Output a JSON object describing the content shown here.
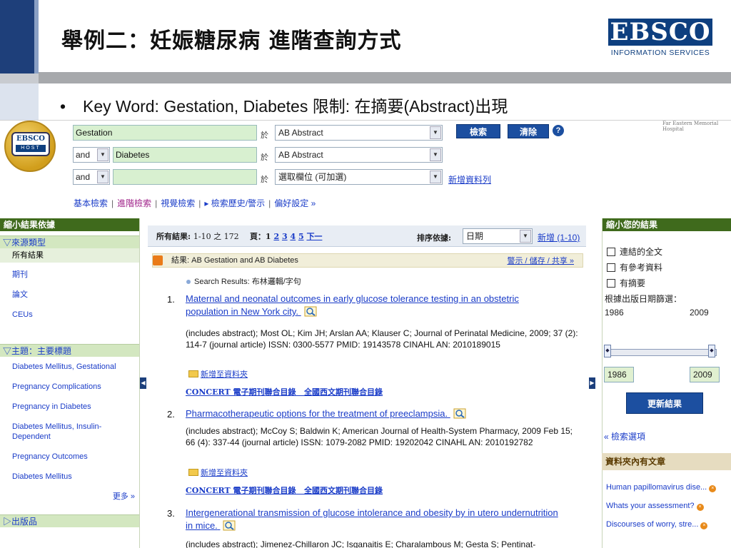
{
  "slide": {
    "title": "舉例二：妊娠糖尿病 進階查詢方式",
    "logo_name": "EBSCO",
    "logo_sub": "INFORMATION SERVICES",
    "bullet_text": "Key Word: Gestation, Diabetes  限制: 在摘要(Abstract)出現"
  },
  "search": {
    "host_logo_top": "EBSCO",
    "host_logo_bottom": "HOST",
    "row1_term": "Gestation",
    "row2_op": "and",
    "row2_term": "Diabetes",
    "row3_op": "and",
    "row3_term": "",
    "yu": "於",
    "row1_field": "AB Abstract",
    "row2_field": "AB Abstract",
    "row3_field": "選取欄位 (可加選)",
    "search_btn": "檢索",
    "clear_btn": "清除",
    "help": "?",
    "add_row": "新增資料列",
    "tabs": [
      "基本檢索",
      "進階檢索",
      "視覺檢索"
    ],
    "history": "▸ 檢索歷史/警示",
    "prefs": "偏好設定 »",
    "topright": "Far Eastern Memorial Hospital"
  },
  "left": {
    "title": "縮小結果依據",
    "source_types_header": "▽來源類型",
    "source_types": [
      "所有結果",
      "期刊",
      "論文",
      "CEUs"
    ],
    "subject_header": "▽主題：主要標題",
    "subjects": [
      "Diabetes Mellitus, Gestational",
      "Pregnancy Complications",
      "Pregnancy in Diabetes",
      "Diabetes Mellitus, Insulin-Dependent",
      "Pregnancy Outcomes",
      "Diabetes Mellitus"
    ],
    "more": "更多 »",
    "publication_header": "▷出版品"
  },
  "results": {
    "summary_label": "所有結果:",
    "summary_value": "1-10 之 172",
    "page_label": "頁：1",
    "pages": [
      "2",
      "3",
      "4",
      "5",
      "下一"
    ],
    "sort_label": "排序依據:",
    "sort_value": "日期",
    "newest": "新增 (1-10)",
    "feed_text": "結果: AB Gestation and AB Diabetes",
    "feed_actions": "警示 / 儲存 / 共享 »",
    "search_results_text": "Search Results: 布林邏輯/字句",
    "add_folder": "新增至資料夾",
    "link_concert": "CONCERT 電子期刊聯合目錄",
    "link_union": "全國西文期刊聯合目錄",
    "items": [
      {
        "num": "1.",
        "title": "Maternal and neonatal outcomes in early glucose tolerance testing in an obstetric population in New York city.",
        "meta": "(includes abstract); Most OL; Kim JH; Arslan AA; Klauser C; Journal of Perinatal Medicine, 2009; 37 (2): 114-7 (journal article) ISSN: 0300-5577 PMID: 19143578 CINAHL AN: 2010189015"
      },
      {
        "num": "2.",
        "title": "Pharmacotherapeutic options for the treatment of preeclampsia.",
        "meta": "(includes abstract); McCoy S; Baldwin K; American Journal of Health-System Pharmacy, 2009 Feb 15; 66 (4): 337-44 (journal article) ISSN: 1079-2082 PMID: 19202042 CINAHL AN: 2010192782"
      },
      {
        "num": "3.",
        "title": "Intergenerational transmission of glucose intolerance and obesity by in utero undernutrition in mice.",
        "meta": "(includes abstract); Jimenez-Chillaron JC; Isganaitis E; Charalambous M; Gesta S; Pentinat-"
      }
    ]
  },
  "right": {
    "title": "縮小您的結果",
    "checks": [
      "連結的全文",
      "有參考資料",
      "有摘要"
    ],
    "date_label": "根據出版日期篩選：",
    "date_from": "1986",
    "date_to": "2009",
    "update_btn": "更新結果",
    "options_link": "« 檢索選項",
    "folder_header": "資料夾內有文章",
    "folder_items": [
      "Human papillomavirus dise...",
      "Whats your assessment?",
      "Discourses of worry, stre..."
    ]
  }
}
